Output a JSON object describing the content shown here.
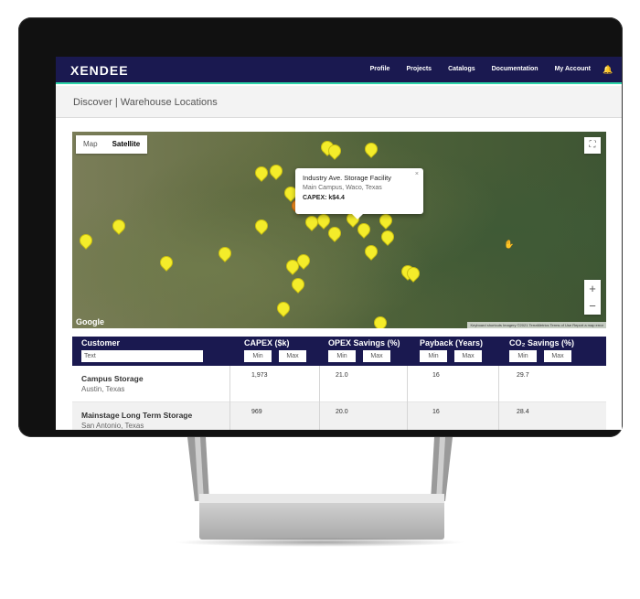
{
  "app": {
    "logo": "XENDEE",
    "nav": [
      "Profile",
      "Projects",
      "Catalogs",
      "Documentation",
      "My Account"
    ],
    "bell_icon": "bell-icon"
  },
  "page": {
    "title": "Discover | Warehouse Locations"
  },
  "map": {
    "type_options": [
      "Map",
      "Satellite"
    ],
    "active_type": "Satellite",
    "zoom_in": "+",
    "zoom_out": "−",
    "google_label": "Google",
    "attribution": "Keyboard shortcuts   Imagery ©2021 TerraMetrics   Terms of Use   Report a map error",
    "popup": {
      "name": "Industry Ave. Storage Facility",
      "location": "Main Campus, Waco, Texas",
      "capex": "CAPEX: k$4.4",
      "close": "×"
    }
  },
  "table": {
    "headers": {
      "customer": "Customer",
      "capex": "CAPEX ($k)",
      "opex": "OPEX Savings (%)",
      "payback": "Payback (Years)",
      "co2": "CO₂ Savings (%)"
    },
    "filter_placeholder": "Text",
    "min_label": "Min",
    "max_label": "Max",
    "rows": [
      {
        "name": "Campus Storage",
        "location": "Austin, Texas",
        "capex": "1,973",
        "opex": "21.0",
        "payback": "16",
        "co2": "29.7"
      },
      {
        "name": "Mainstage Long Term Storage",
        "location": "San Antonio, Texas",
        "capex": "969",
        "opex": "20.0",
        "payback": "16",
        "co2": "28.4"
      }
    ]
  }
}
